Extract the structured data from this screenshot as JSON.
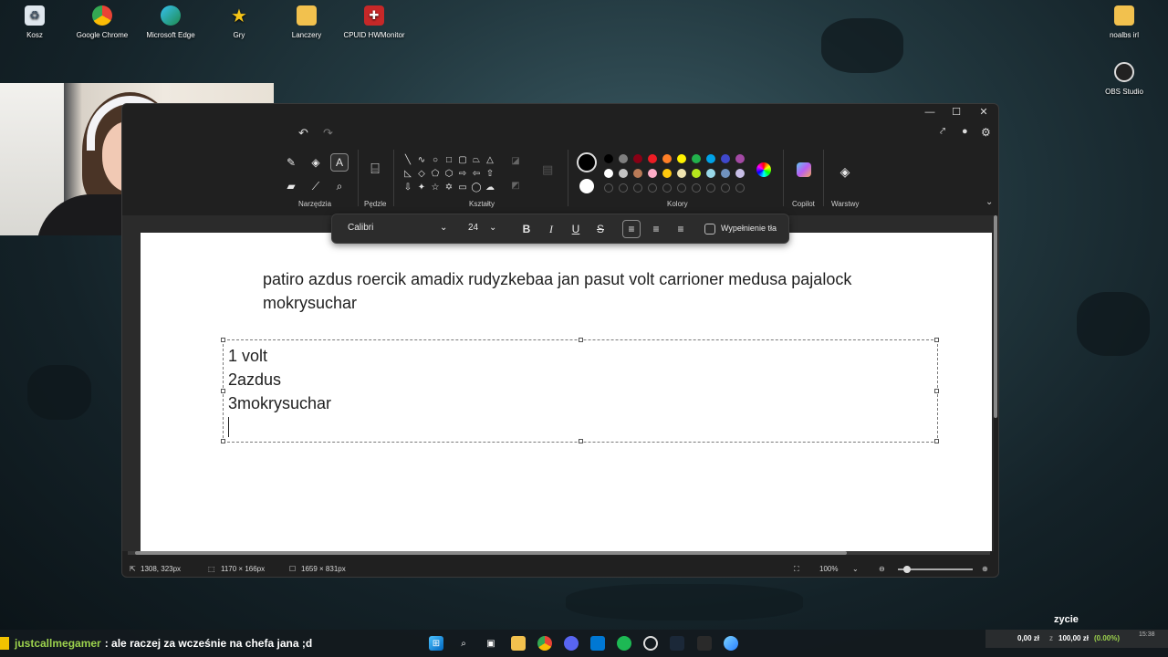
{
  "desktop_icons": [
    {
      "label": "Kosz",
      "icon": "recycle-bin-icon"
    },
    {
      "label": "Google Chrome",
      "icon": "chrome-icon"
    },
    {
      "label": "Microsoft Edge",
      "icon": "edge-icon"
    },
    {
      "label": "Gry",
      "icon": "star-icon"
    },
    {
      "label": "Lanczery",
      "icon": "folder-icon"
    },
    {
      "label": "CPUID HWMonitor",
      "icon": "hwmonitor-icon"
    },
    {
      "label": "noalbs irl",
      "icon": "folder-icon"
    },
    {
      "label": "OBS Studio",
      "icon": "obs-icon"
    }
  ],
  "paint": {
    "groups": {
      "tools": "Narzędzia",
      "brushes": "Pędzle",
      "shapes": "Kształty",
      "colors": "Kolory",
      "copilot": "Copilot",
      "layers": "Warstwy"
    },
    "format_bar": {
      "font": "Calibri",
      "size": "24",
      "bold": "B",
      "italic": "I",
      "underline": "U",
      "strike": "S",
      "fill_label": "Wypełnienie tła"
    },
    "canvas_text_1": "patiro azdus roercik amadix rudyzkebaa jan pasut volt carrioner medusa pajalock mokrysuchar",
    "textbox_lines": [
      "1 volt",
      "2azdus",
      "3mokrysuchar"
    ],
    "status": {
      "cursor": "1308, 323px",
      "selection": "1170 × 166px",
      "canvas_size": "1659 × 831px",
      "zoom": "100%"
    },
    "palette": [
      "#000000",
      "#7f7f7f",
      "#880015",
      "#ed1c24",
      "#ff7f27",
      "#fff200",
      "#22b14c",
      "#00a2e8",
      "#3f48cc",
      "#a349a4",
      "#ffffff",
      "#c3c3c3",
      "#b97a57",
      "#ffaec9",
      "#ffc90e",
      "#efe4b0",
      "#b5e61d",
      "#99d9ea",
      "#7092be",
      "#c8bfe7"
    ]
  },
  "chat": {
    "user": "justcallmegamer",
    "message": ": ale raczej za wcześnie na chefa jana ;d"
  },
  "ticker": {
    "left": "0,00 zł",
    "right": "100,00 zł",
    "pct": "(0.00%)",
    "time": "15:38"
  },
  "overlay_label": "zycie"
}
